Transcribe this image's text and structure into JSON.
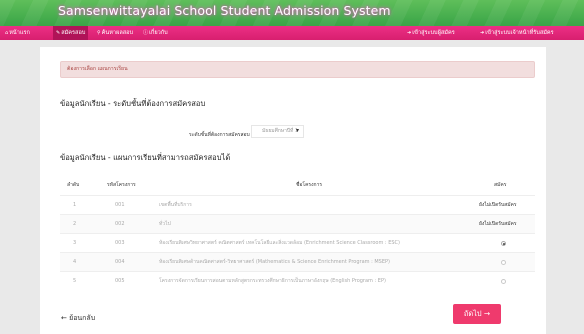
{
  "header": {
    "title": "Samsenwittayalai School Student Admission System",
    "colors": {
      "header_green": "#3fa84a",
      "nav_pink": "#e0256f",
      "title_glow": "#f26ad1",
      "primary_button": "#ef3a6d"
    }
  },
  "nav": {
    "items": [
      {
        "icon": "home-icon",
        "glyph": "⌂",
        "label": "หน้าแรก"
      },
      {
        "icon": "edit-icon",
        "glyph": "✎",
        "label": "สมัครสอบ"
      },
      {
        "icon": "search-icon",
        "glyph": "⚲",
        "label": "ค้นหาผลสอบ"
      },
      {
        "icon": "info-icon",
        "glyph": "ⓘ",
        "label": "เกี่ยวกับ"
      }
    ],
    "right": [
      {
        "icon": "login-icon",
        "glyph": "➜",
        "label": "เข้าสู่ระบบผู้สมัคร"
      },
      {
        "icon": "login-icon",
        "glyph": "➜",
        "label": "เข้าสู่ระบบเจ้าหน้าที่รับสมัคร"
      }
    ]
  },
  "alert": {
    "text": "ต้องการเลือก แผนการเรียน"
  },
  "section_level": {
    "title": "ข้อมูลนักเรียน - ระดับชั้นที่ต้องการสมัครสอบ"
  },
  "level_field": {
    "label": "ระดับชั้นที่ต้องการสมัครสอบ",
    "value": "มัธยมศึกษาปีที่ 1",
    "caret": "▾"
  },
  "section_plan": {
    "title": "ข้อมูลนักเรียน - แผนการเรียนที่สามารถสมัครสอบได้"
  },
  "table": {
    "headers": {
      "seq": "ลำดับ",
      "code": "รหัสโครงการ",
      "name": "ชื่อโครงการ",
      "apply": "สมัคร"
    },
    "rows": [
      {
        "seq": "1",
        "code": "001",
        "name": "เขตพื้นที่บริการ",
        "apply": "ยังไม่เปิดรับสมัคร",
        "type": "closed"
      },
      {
        "seq": "2",
        "code": "002",
        "name": "ทั่วไป",
        "apply": "ยังไม่เปิดรับสมัคร",
        "type": "closed"
      },
      {
        "seq": "3",
        "code": "003",
        "name": "ห้องเรียนพิเศษวิทยาศาสตร์ คณิตศาสตร์ เทคโนโลยีและสิ่งแวดล้อม (Enrichment Science Classroom : ESC)",
        "apply": "",
        "type": "radio",
        "checked": true
      },
      {
        "seq": "4",
        "code": "004",
        "name": "ห้องเรียนพิเศษด้านคณิตศาสตร์-วิทยาศาสตร์ (Mathematics & Science Enrichment Program : MSEP)",
        "apply": "",
        "type": "radio",
        "checked": false
      },
      {
        "seq": "5",
        "code": "005",
        "name": "โครงการจัดการเรียนการสอนตามหลักสูตรกระทรวงศึกษาธิการเป็นภาษาอังกฤษ (English Program : EP)",
        "apply": "",
        "type": "radio",
        "checked": false
      }
    ]
  },
  "buttons": {
    "back": "← ย้อนกลับ",
    "next": "ถัดไป →"
  }
}
